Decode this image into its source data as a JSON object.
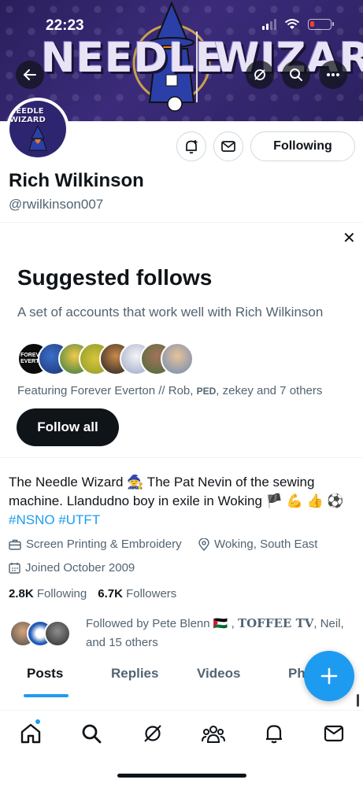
{
  "status_bar": {
    "time": "22:23",
    "battery_level": 0.2
  },
  "banner": {
    "title_left": "NEEDLE",
    "title_right": "WIZARD"
  },
  "avatar": {
    "label": "NEEDLE WIZARD"
  },
  "profile": {
    "following_label": "Following",
    "display_name": "Rich Wilkinson",
    "handle": "@rwilkinson007"
  },
  "suggested": {
    "close_label": "✕",
    "title": "Suggested follows",
    "subtitle": "A set of accounts that work well with Rich Wilkinson",
    "first_avatar_label": "FOREVER EVERTON",
    "featuring_prefix": "Featuring Forever Everton // Rob, ",
    "featuring_ped": "PED",
    "featuring_suffix": ", zekey and 7 others",
    "follow_all_label": "Follow all"
  },
  "bio": {
    "line1": "The Needle Wizard 🧙 The Pat Nevin of the sewing machine. Llandudno boy in exile in Woking 🏴 💪 👍 ⚽",
    "hashtag1": "#NSNO",
    "hashtag2": "#UTFT",
    "category": "Screen Printing & Embroidery",
    "location": "Woking, South East",
    "joined": "Joined October 2009"
  },
  "stats": {
    "following_count": "2.8K",
    "following_label": "Following",
    "followers_count": "6.7K",
    "followers_label": "Followers"
  },
  "followed_by": {
    "prefix": "Followed by Pete Blenn 🇵🇸 , ",
    "toffee": "TOFFEE TV",
    "suffix": ", Neil, and 15 others"
  },
  "tabs": [
    {
      "label": "Posts",
      "active": true
    },
    {
      "label": "Replies",
      "active": false
    },
    {
      "label": "Videos",
      "active": false
    },
    {
      "label": "Photos",
      "active": false
    }
  ],
  "fab_label": "+",
  "colors": {
    "accent": "#1d9bf0",
    "text": "#0f1419",
    "muted": "#536471",
    "banner": "#2a1f5c"
  },
  "nav_icons": [
    "home-icon",
    "search-icon",
    "grok-icon",
    "communities-icon",
    "notifications-icon",
    "messages-icon"
  ]
}
